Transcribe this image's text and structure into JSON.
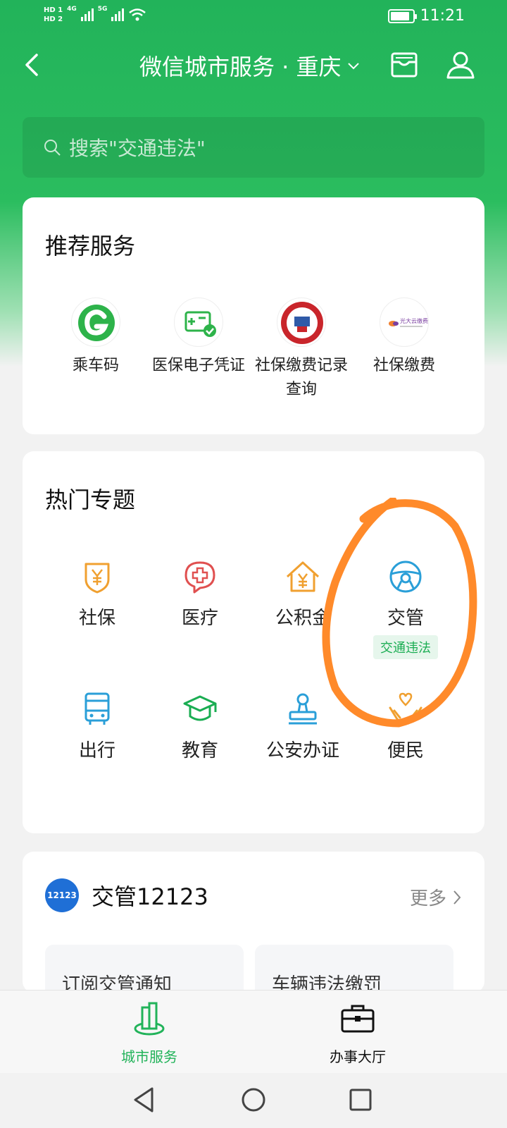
{
  "status_bar": {
    "hd1": "HD 1",
    "hd2": "HD 2",
    "net1": "4G",
    "net2": "5G",
    "time": "11:21"
  },
  "header": {
    "title": "微信城市服务 · 重庆",
    "icons": [
      "back-icon",
      "chevron-down-icon",
      "card-package-icon",
      "user-icon"
    ]
  },
  "search": {
    "placeholder": "搜索\"交通违法\""
  },
  "recommended": {
    "title": "推荐服务",
    "items": [
      {
        "label": "乘车码",
        "icon": "bus-code-icon"
      },
      {
        "label": "医保电子凭证",
        "icon": "medical-insurance-voucher-icon"
      },
      {
        "label": "社保缴费记录查询",
        "icon": "social-security-card-icon"
      },
      {
        "label": "社保缴费",
        "icon": "everbright-cloud-payment-icon"
      }
    ],
    "logo_text": "光大云缴费"
  },
  "hot_topics": {
    "title": "热门专题",
    "items": [
      {
        "label": "社保",
        "icon": "shield-yen-icon",
        "color": "#f0a030"
      },
      {
        "label": "医疗",
        "icon": "medical-cross-icon",
        "color": "#e05050"
      },
      {
        "label": "公积金",
        "icon": "house-yen-icon",
        "color": "#f0a030"
      },
      {
        "label": "交管",
        "icon": "steering-wheel-icon",
        "color": "#2a9fd8",
        "tag": "交通违法"
      },
      {
        "label": "出行",
        "icon": "bus-icon",
        "color": "#2a9fd8"
      },
      {
        "label": "教育",
        "icon": "graduation-cap-icon",
        "color": "#1aad52"
      },
      {
        "label": "公安办证",
        "icon": "stamp-icon",
        "color": "#2a9fd8"
      },
      {
        "label": "便民",
        "icon": "hands-heart-icon",
        "color": "#f0a030"
      }
    ]
  },
  "traffic": {
    "badge": "12123",
    "title": "交管12123",
    "more": "更多",
    "subcards": [
      "订阅交管通知",
      "车辆违法缴罚"
    ]
  },
  "tabbar": {
    "tabs": [
      {
        "label": "城市服务",
        "icon": "city-buildings-icon",
        "active": true
      },
      {
        "label": "办事大厅",
        "icon": "briefcase-icon",
        "active": false
      }
    ]
  },
  "colors": {
    "brand_green": "#22b35a",
    "annotation_orange": "#ff8a2a"
  }
}
